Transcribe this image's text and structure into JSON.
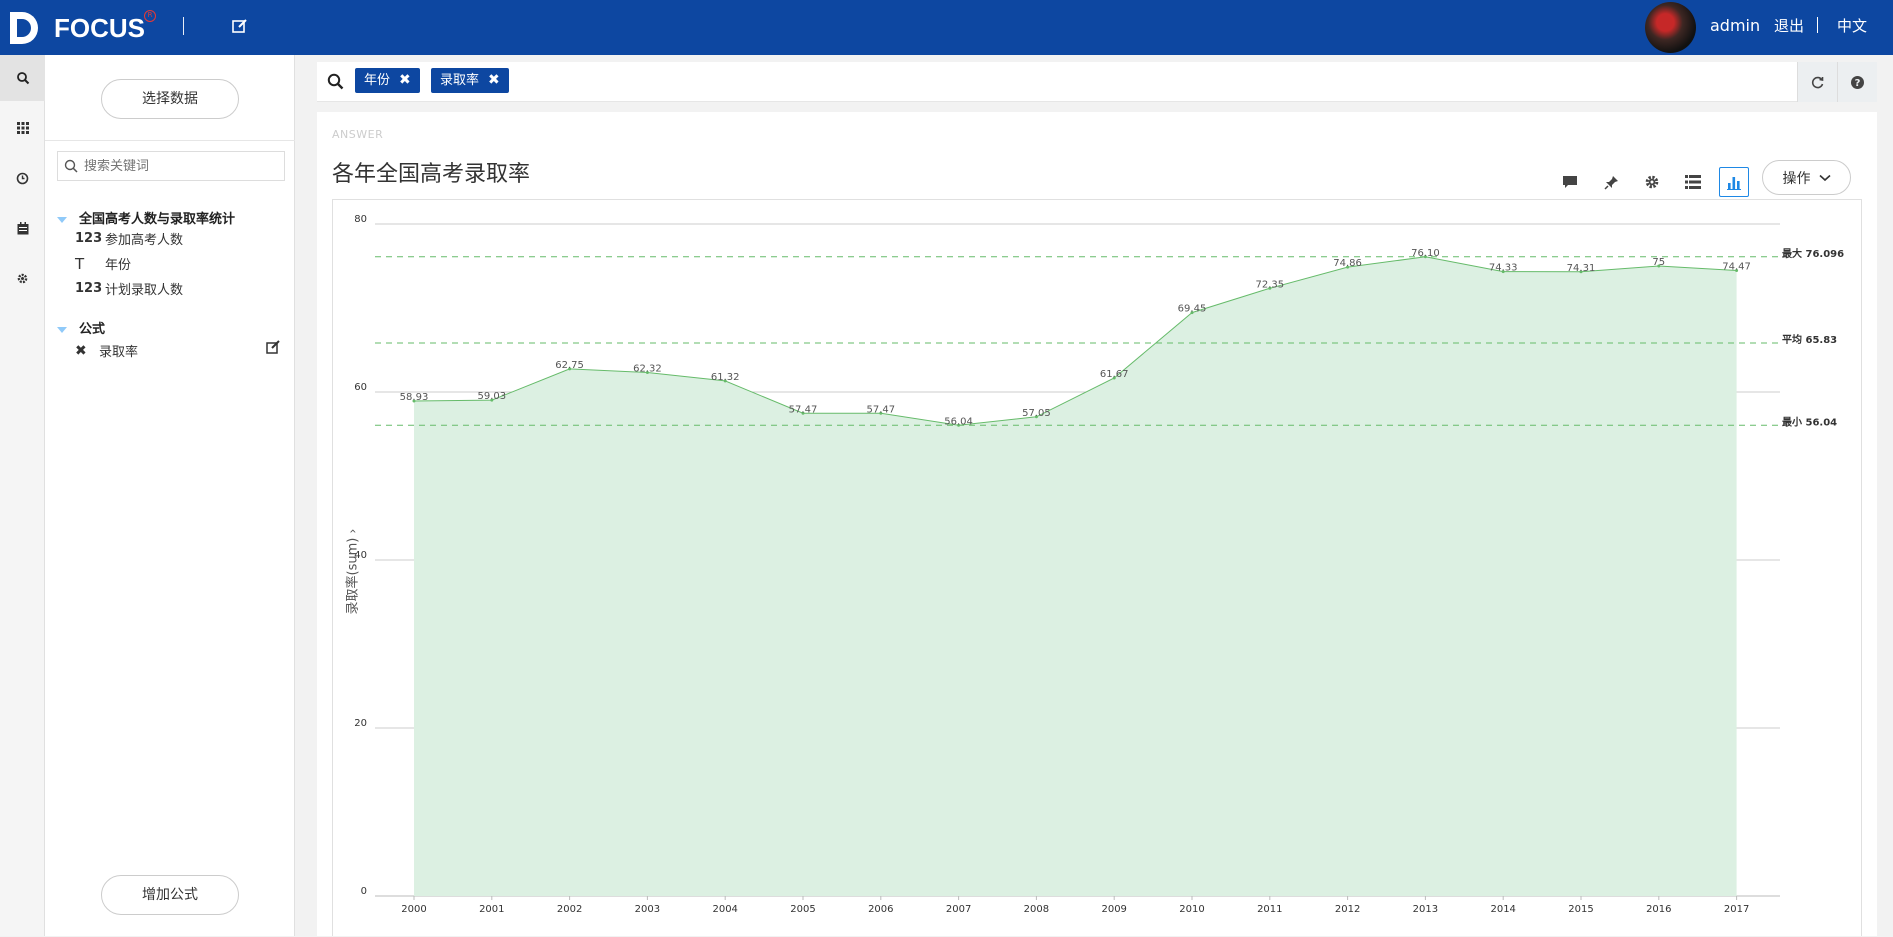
{
  "topbar": {
    "logo_text": "FOCUS",
    "user_name": "admin",
    "logout_label": "退出",
    "language_label": "中文"
  },
  "rail": [
    "search-icon",
    "grid-icon",
    "history-icon",
    "calendar-icon",
    "settings-icon"
  ],
  "side": {
    "select_data_label": "选择数据",
    "search_placeholder": "搜索关键词",
    "group1_label": "全国高考人数与录取率统计",
    "fields": [
      {
        "type": "123",
        "label": "参加高考人数"
      },
      {
        "type": "T",
        "label": "年份"
      },
      {
        "type": "123",
        "label": "计划录取人数"
      }
    ],
    "group2_label": "公式",
    "formula_label": "录取率",
    "add_formula_label": "增加公式"
  },
  "query": {
    "tokens": [
      "年份",
      "录取率"
    ]
  },
  "answer": {
    "label": "ANSWER",
    "title": "各年全国高考录取率",
    "operate_label": "操作",
    "y_axis_title": "录取率(sum)"
  },
  "colors": {
    "brand": "#0d47a1",
    "area_fill": "#dcf0e2",
    "area_line": "#66bb6a",
    "ref_line": "#66bb6a"
  },
  "chart_data": {
    "type": "area",
    "categories": [
      "2000",
      "2001",
      "2002",
      "2003",
      "2004",
      "2005",
      "2006",
      "2007",
      "2008",
      "2009",
      "2010",
      "2011",
      "2012",
      "2013",
      "2014",
      "2015",
      "2016",
      "2017"
    ],
    "values": [
      58.93,
      59.03,
      62.75,
      62.32,
      61.32,
      57.47,
      57.47,
      56.04,
      57.05,
      61.67,
      69.45,
      72.35,
      74.86,
      76.1,
      74.33,
      74.31,
      75,
      74.47
    ],
    "value_labels": [
      "58.93",
      "59.03",
      "62.75",
      "62.32",
      "61.32",
      "57.47",
      "57.47",
      "56.04",
      "57.05",
      "61.67",
      "69.45",
      "72.35",
      "74.86",
      "76.10",
      "74.33",
      "74.31",
      "75",
      "74.47"
    ],
    "ylim": [
      0,
      80
    ],
    "yticks": [
      0,
      20,
      40,
      60,
      80
    ],
    "ylabel": "录取率(sum)",
    "reference_lines": [
      {
        "label": "最大 76.096",
        "value": 76.096
      },
      {
        "label": "平均 65.83",
        "value": 65.83
      },
      {
        "label": "最小 56.04",
        "value": 56.04
      }
    ],
    "grid": true
  }
}
